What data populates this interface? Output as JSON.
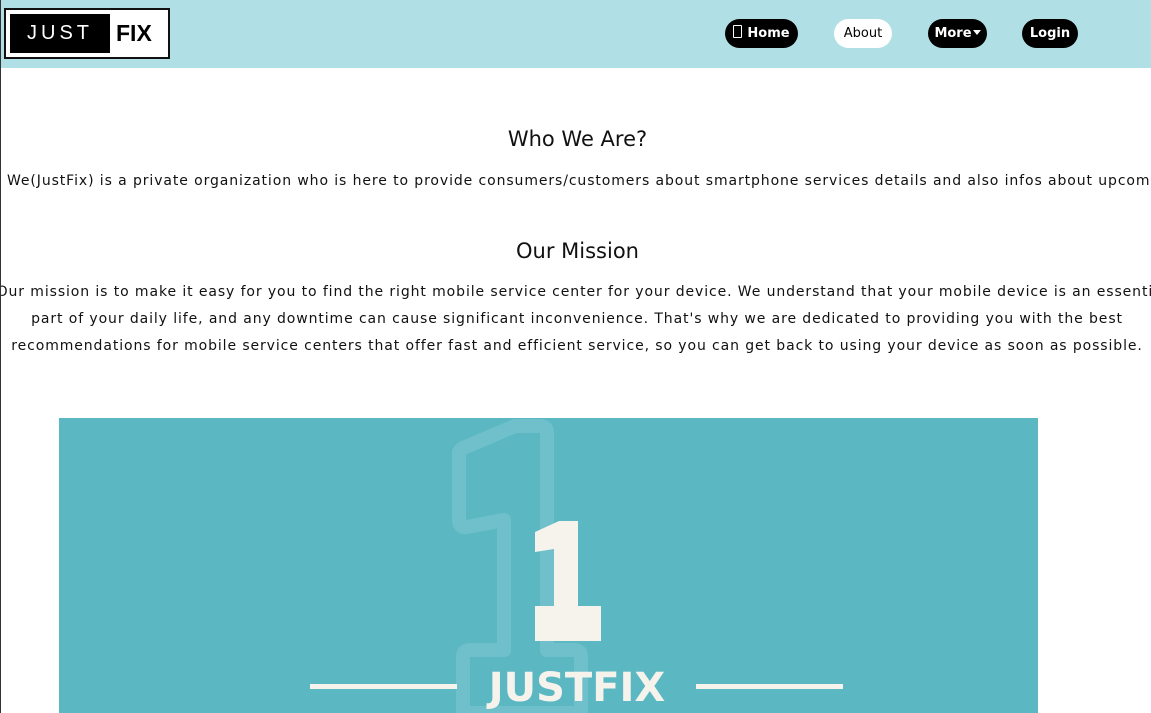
{
  "header": {
    "logo": {
      "part1": "JUST",
      "part2": "FIX"
    },
    "nav": [
      {
        "label": "Home",
        "icon": "mobile-phone-icon",
        "active": false
      },
      {
        "label": "About",
        "active": true
      },
      {
        "label": "More",
        "icon": "caret-down-icon",
        "active": false
      },
      {
        "label": "Login",
        "active": false
      }
    ]
  },
  "who": {
    "title": "Who We Are?",
    "text": "We(JustFix) is a private organization who is here to provide consumers/customers about smartphone services details and also infos about upcoming"
  },
  "mission": {
    "title": "Our Mission",
    "lines": [
      "Our mission is to make it easy for you to find the right mobile service center for your device. We understand that your mobile device is an essential",
      "part of your daily life, and any downtime can cause significant inconvenience. That's why we are dedicated to providing you with the best",
      "recommendations for mobile service centers that offer fast and efficient service, so you can get back to using your device as soon as possible."
    ]
  },
  "banner": {
    "logo_number": "1",
    "logo_text": "JUSTFIX"
  },
  "colors": {
    "header_bg": "#b0dfe5",
    "banner_bg": "#5bb8c3",
    "logo_cream": "#f5f3ec"
  }
}
